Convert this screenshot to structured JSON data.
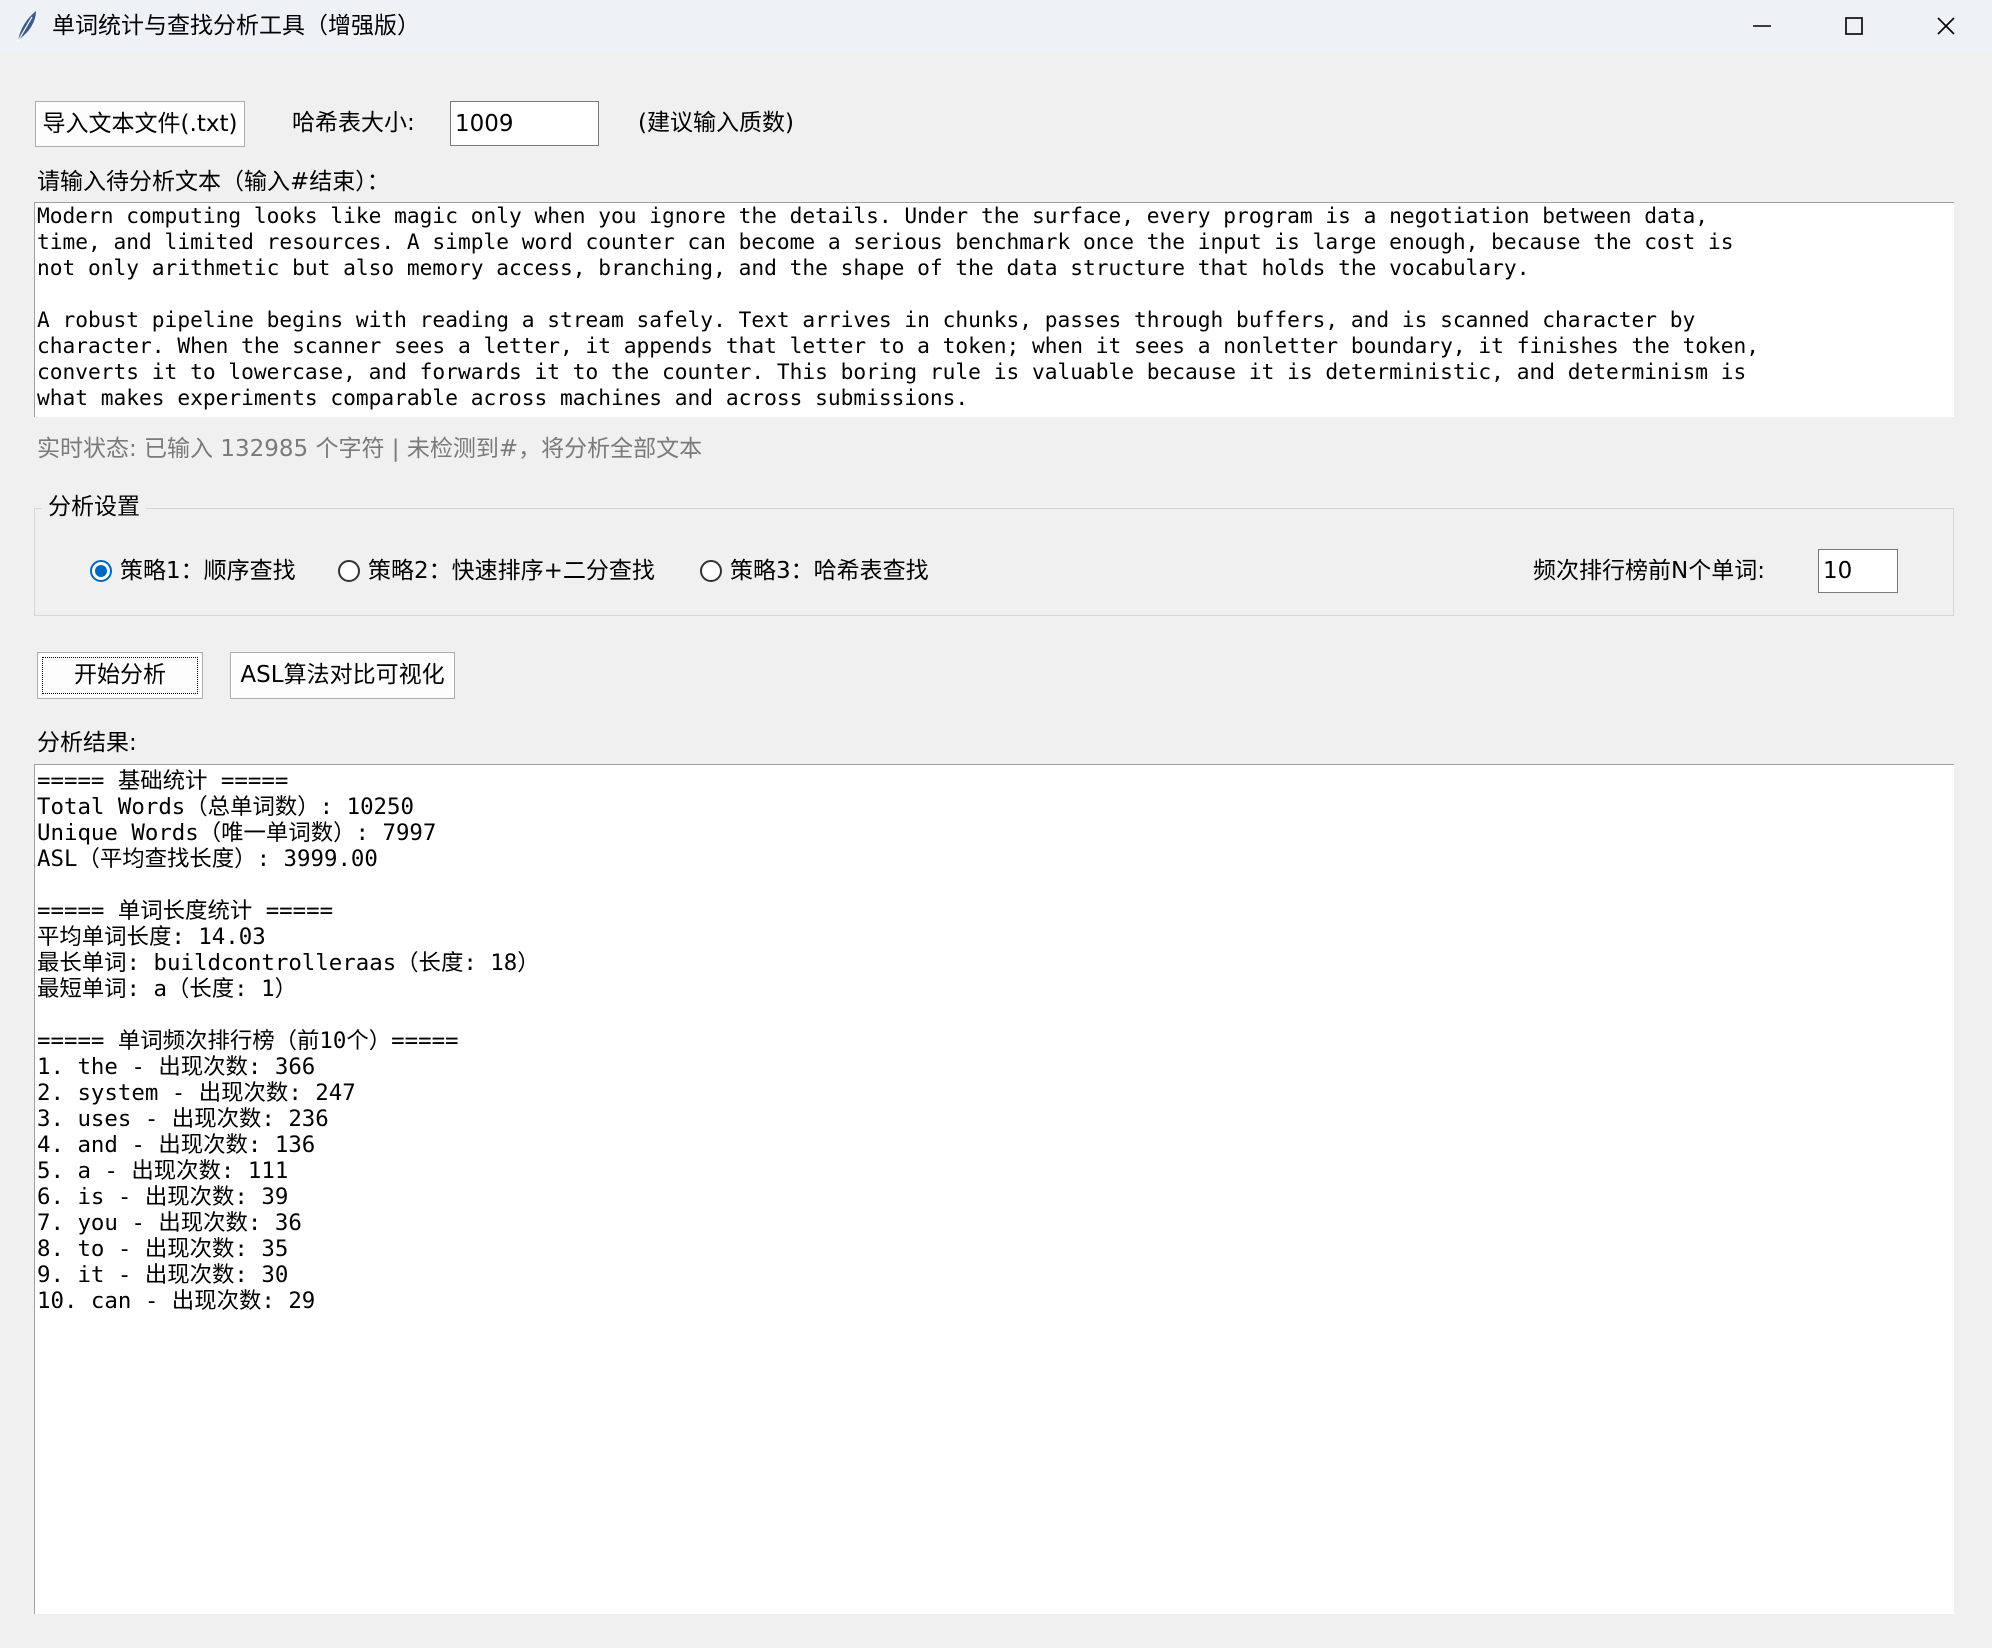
{
  "window": {
    "title": "单词统计与查找分析工具（增强版）"
  },
  "toolbar": {
    "import_label": "导入文本文件(.txt)",
    "hash_size_label": "哈希表大小:",
    "hash_size_value": "1009",
    "hash_size_hint": "(建议输入质数)"
  },
  "input": {
    "label": "请输入待分析文本（输入#结束）：",
    "text": "Modern computing looks like magic only when you ignore the details. Under the surface, every program is a negotiation between data,\ntime, and limited resources. A simple word counter can become a serious benchmark once the input is large enough, because the cost is\nnot only arithmetic but also memory access, branching, and the shape of the data structure that holds the vocabulary.\n\nA robust pipeline begins with reading a stream safely. Text arrives in chunks, passes through buffers, and is scanned character by\ncharacter. When the scanner sees a letter, it appends that letter to a token; when it sees a nonletter boundary, it finishes the token,\nconverts it to lowercase, and forwards it to the counter. This boring rule is valuable because it is deterministic, and determinism is\nwhat makes experiments comparable across machines and across submissions."
  },
  "status": {
    "text": "实时状态: 已输入 132985 个字符 | 未检测到#，将分析全部文本"
  },
  "settings": {
    "title": "分析设置",
    "strategies": [
      {
        "label": "策略1：顺序查找",
        "selected": true
      },
      {
        "label": "策略2：快速排序+二分查找",
        "selected": false
      },
      {
        "label": "策略3：哈希表查找",
        "selected": false
      }
    ],
    "topn_label": "频次排行榜前N个单词:",
    "topn_value": "10"
  },
  "actions": {
    "start_label": "开始分析",
    "asl_label": "ASL算法对比可视化"
  },
  "results": {
    "label": "分析结果:",
    "text": "===== 基础统计 =====\nTotal Words（总单词数）: 10250\nUnique Words（唯一单词数）: 7997\nASL（平均查找长度）: 3999.00\n\n===== 单词长度统计 =====\n平均单词长度: 14.03\n最长单词: buildcontrolleraas（长度: 18）\n最短单词: a（长度: 1）\n\n===== 单词频次排行榜（前10个）=====\n1. the - 出现次数: 366\n2. system - 出现次数: 247\n3. uses - 出现次数: 236\n4. and - 出现次数: 136\n5. a - 出现次数: 111\n6. is - 出现次数: 39\n7. you - 出现次数: 36\n8. to - 出现次数: 35\n9. it - 出现次数: 30\n10. can - 出现次数: 29"
  },
  "colors": {
    "accent": "#0067c0",
    "status_text": "#7a7a7a"
  }
}
